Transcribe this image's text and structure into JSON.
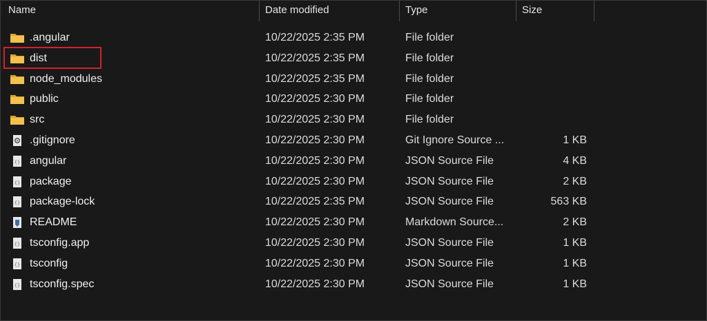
{
  "columns": {
    "name": "Name",
    "date": "Date modified",
    "type": "Type",
    "size": "Size"
  },
  "colors": {
    "folder": "#f2c14e",
    "highlight": "#d0232f"
  },
  "files": [
    {
      "name": ".angular",
      "date": "10/22/2025 2:35 PM",
      "type": "File folder",
      "size": "",
      "icon": "folder-icon"
    },
    {
      "name": "dist",
      "date": "10/22/2025 2:35 PM",
      "type": "File folder",
      "size": "",
      "icon": "folder-icon",
      "highlighted": true
    },
    {
      "name": "node_modules",
      "date": "10/22/2025 2:35 PM",
      "type": "File folder",
      "size": "",
      "icon": "folder-icon"
    },
    {
      "name": "public",
      "date": "10/22/2025 2:30 PM",
      "type": "File folder",
      "size": "",
      "icon": "folder-icon"
    },
    {
      "name": "src",
      "date": "10/22/2025 2:30 PM",
      "type": "File folder",
      "size": "",
      "icon": "folder-icon"
    },
    {
      "name": ".gitignore",
      "date": "10/22/2025 2:30 PM",
      "type": "Git Ignore Source ...",
      "size": "1 KB",
      "icon": "gitignore-file-icon"
    },
    {
      "name": "angular",
      "date": "10/22/2025 2:30 PM",
      "type": "JSON Source File",
      "size": "4 KB",
      "icon": "json-file-icon"
    },
    {
      "name": "package",
      "date": "10/22/2025 2:30 PM",
      "type": "JSON Source File",
      "size": "2 KB",
      "icon": "json-file-icon"
    },
    {
      "name": "package-lock",
      "date": "10/22/2025 2:35 PM",
      "type": "JSON Source File",
      "size": "563 KB",
      "icon": "json-file-icon"
    },
    {
      "name": "README",
      "date": "10/22/2025 2:30 PM",
      "type": "Markdown Source...",
      "size": "2 KB",
      "icon": "markdown-file-icon"
    },
    {
      "name": "tsconfig.app",
      "date": "10/22/2025 2:30 PM",
      "type": "JSON Source File",
      "size": "1 KB",
      "icon": "json-file-icon"
    },
    {
      "name": "tsconfig",
      "date": "10/22/2025 2:30 PM",
      "type": "JSON Source File",
      "size": "1 KB",
      "icon": "json-file-icon"
    },
    {
      "name": "tsconfig.spec",
      "date": "10/22/2025 2:30 PM",
      "type": "JSON Source File",
      "size": "1 KB",
      "icon": "json-file-icon"
    }
  ]
}
